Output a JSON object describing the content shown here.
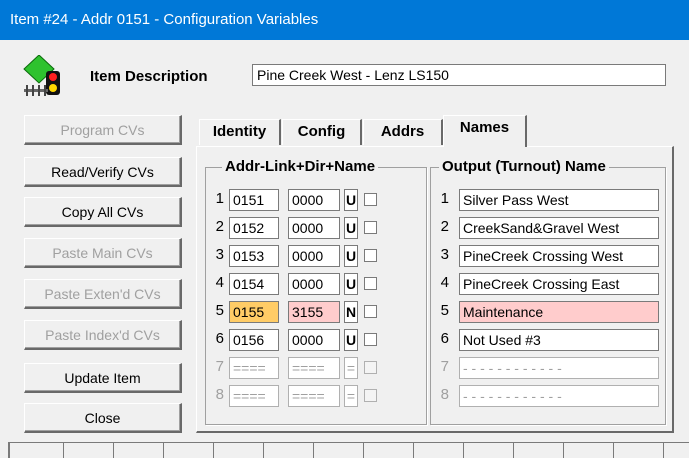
{
  "window": {
    "title": "Item #24 - Addr 0151 - Configuration Variables"
  },
  "item": {
    "description_label": "Item Description",
    "description_value": "Pine Creek West - Lenz LS150"
  },
  "buttons": [
    {
      "label": "Program CVs",
      "enabled": false
    },
    {
      "label": "Read/Verify CVs",
      "enabled": true
    },
    {
      "label": "Copy All CVs",
      "enabled": true
    },
    {
      "label": "Paste Main CVs",
      "enabled": false
    },
    {
      "label": "Paste Exten'd CVs",
      "enabled": false
    },
    {
      "label": "Paste Index'd CVs",
      "enabled": false
    },
    {
      "label": "Update Item",
      "enabled": true
    },
    {
      "label": "Close",
      "enabled": true
    }
  ],
  "tabs": [
    {
      "label": "Identity"
    },
    {
      "label": "Config"
    },
    {
      "label": "Addrs"
    },
    {
      "label": "Names",
      "active": true
    }
  ],
  "addr_group": {
    "title": "Addr-Link+Dir+Name",
    "rows": [
      {
        "num": "1",
        "addr": "0151",
        "link": "0000",
        "dir": "U"
      },
      {
        "num": "2",
        "addr": "0152",
        "link": "0000",
        "dir": "U"
      },
      {
        "num": "3",
        "addr": "0153",
        "link": "0000",
        "dir": "U"
      },
      {
        "num": "4",
        "addr": "0154",
        "link": "0000",
        "dir": "U"
      },
      {
        "num": "5",
        "addr": "0155",
        "link": "3155",
        "dir": "N"
      },
      {
        "num": "6",
        "addr": "0156",
        "link": "0000",
        "dir": "U"
      },
      {
        "num": "7",
        "addr": "====",
        "link": "====",
        "dir": "="
      },
      {
        "num": "8",
        "addr": "====",
        "link": "====",
        "dir": "="
      }
    ]
  },
  "output_group": {
    "title": "Output (Turnout) Name",
    "rows": [
      {
        "num": "1",
        "name": "Silver Pass West"
      },
      {
        "num": "2",
        "name": "CreekSand&Gravel West"
      },
      {
        "num": "3",
        "name": "PineCreek Crossing West"
      },
      {
        "num": "4",
        "name": "PineCreek Crossing East"
      },
      {
        "num": "5",
        "name": "Maintenance"
      },
      {
        "num": "6",
        "name": "Not Used #3"
      },
      {
        "num": "7",
        "name": "- - - - - - - - - - - -"
      },
      {
        "num": "8",
        "name": "- - - - - - - - - - - -"
      }
    ]
  },
  "colors": {
    "titlebar": "#0078d7",
    "highlight_orange": "#ffcc66",
    "highlight_pink": "#ffcccc"
  }
}
